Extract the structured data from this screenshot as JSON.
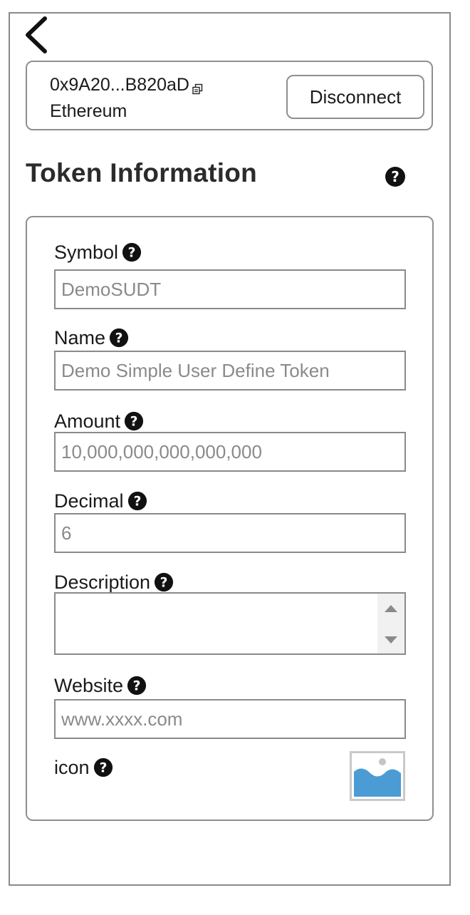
{
  "header": {
    "back_icon": "chevron-left-icon"
  },
  "wallet": {
    "address": "0x9A20...B820aD",
    "copy_icon": "copy-icon",
    "network": "Ethereum",
    "disconnect_label": "Disconnect"
  },
  "section": {
    "title": "Token Information",
    "help_icon": "question-circle-icon"
  },
  "form": {
    "symbol": {
      "label": "Symbol",
      "placeholder": "DemoSUDT",
      "value": ""
    },
    "name": {
      "label": "Name",
      "placeholder": "Demo Simple User Define Token",
      "value": ""
    },
    "amount": {
      "label": "Amount",
      "placeholder": "10,000,000,000,000,000",
      "value": ""
    },
    "decimal": {
      "label": "Decimal",
      "placeholder": "6",
      "value": ""
    },
    "description": {
      "label": "Description",
      "value": ""
    },
    "website": {
      "label": "Website",
      "placeholder": "www.xxxx.com",
      "value": ""
    },
    "icon": {
      "label": "icon",
      "upload_icon": "image-placeholder-icon"
    }
  },
  "colors": {
    "border": "#8f8f8f",
    "text": "#1a1a1a",
    "placeholder": "#8a8a8a",
    "image_accent": "#4b9bd4"
  }
}
